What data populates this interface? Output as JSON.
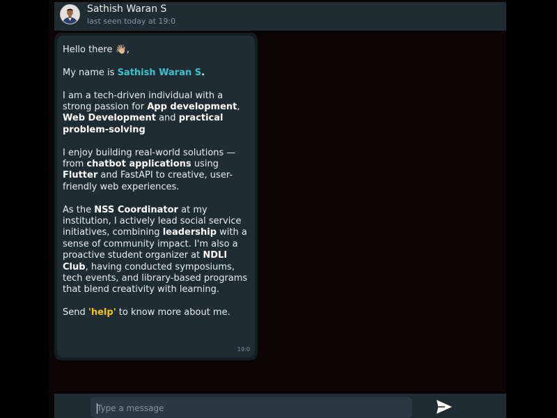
{
  "header": {
    "name": "Sathish Waran S",
    "status": "last seen today at 19:0"
  },
  "message": {
    "greeting_text": "Hello there ",
    "greeting_emoji": "👋🏼",
    "greeting_tail": ",",
    "p2_pre": "My name is ",
    "p2_name": "Sathish Waran S",
    "p2_post": ".",
    "p3_a": "I am a tech-driven individual with a strong passion for ",
    "p3_b": "App development",
    "p3_c": ", ",
    "p3_d": "Web Development",
    "p3_e": " and ",
    "p3_f": "practical problem-solving",
    "p4_a": "I enjoy building real-world solutions — from ",
    "p4_b": "chatbot applications",
    "p4_c": " using ",
    "p4_d": "Flutter",
    "p4_e": " and FastAPI to creative, user-friendly web experiences.",
    "p5_a": "As the ",
    "p5_b": "NSS Coordinator",
    "p5_c": " at my institution, I actively lead social service initiatives, combining ",
    "p5_d": "leadership",
    "p5_e": " with a sense of community impact. I'm also a proactive student organizer at ",
    "p5_f": "NDLI Club",
    "p5_g": ", having conducted symposiums, tech events, and library-based programs that blend creativity with learning.",
    "p6_a": "Send ",
    "p6_b": "'help'",
    "p6_c": " to know more about me.",
    "time": "19:0"
  },
  "composer": {
    "placeholder": "Type a message",
    "send_icon": "send-arrow-icon"
  },
  "colors": {
    "header_bg": "#1f2c33",
    "bubble_bg": "#1f2c33",
    "name_highlight": "#35c4cc",
    "help_highlight": "#f1c40f"
  }
}
